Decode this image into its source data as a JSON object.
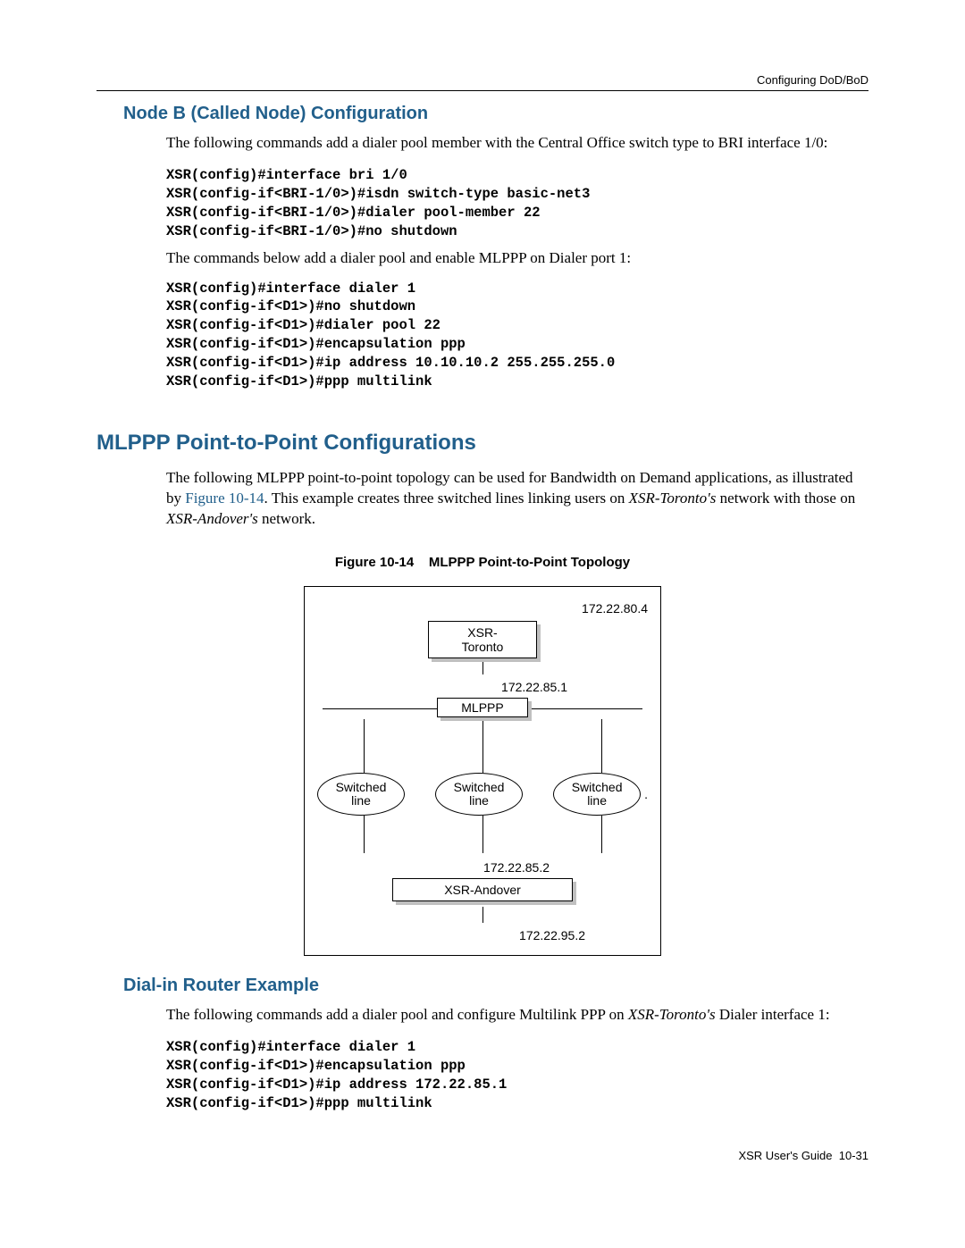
{
  "header": {
    "section": "Configuring DoD/BoD"
  },
  "sec1": {
    "title": "Node B (Called Node) Configuration",
    "p1": "The following commands add a dialer pool member with the Central Office switch type to BRI interface 1/0:",
    "code1": "XSR(config)#interface bri 1/0\nXSR(config-if<BRI-1/0>)#isdn switch-type basic-net3\nXSR(config-if<BRI-1/0>)#dialer pool-member 22\nXSR(config-if<BRI-1/0>)#no shutdown",
    "p2": "The commands below add a dialer pool and enable MLPPP on Dialer port 1:",
    "code2": "XSR(config)#interface dialer 1\nXSR(config-if<D1>)#no shutdown\nXSR(config-if<D1>)#dialer pool 22\nXSR(config-if<D1>)#encapsulation ppp\nXSR(config-if<D1>)#ip address 10.10.10.2 255.255.255.0\nXSR(config-if<D1>)#ppp multilink"
  },
  "sec2": {
    "title": "MLPPP Point-to-Point Configurations",
    "p1a": "The following MLPPP point-to-point topology can be used for Bandwidth on Demand applications, as illustrated by ",
    "fig_link": "Figure 10-14",
    "p1b": ". This example creates three switched lines linking users on ",
    "xsr_t": "XSR-Toronto's",
    "p1c": " network with those on ",
    "xsr_a": "XSR-Andover's",
    "p1d": " network.",
    "fig_caption_num": "Figure 10-14",
    "fig_caption_gap": "    ",
    "fig_caption_title": "MLPPP Point-to-Point Topology"
  },
  "figure": {
    "ip_top": "172.22.80.4",
    "node_top_l1": "XSR-",
    "node_top_l2": "Toronto",
    "ip_mid": "172.22.85.1",
    "mlppp": "MLPPP",
    "sw_l1": "Switched",
    "sw_l2": "line",
    "dot": ".",
    "ip_bot": "172.22.85.2",
    "node_bot": "XSR-Andover",
    "ip_final": "172.22.95.2"
  },
  "sec3": {
    "title": "Dial-in Router Example",
    "p1a": "The following commands add a dialer pool and configure Multilink PPP on ",
    "xsr_t": "XSR-Toronto's",
    "p1b": " Dialer interface 1:",
    "code1": "XSR(config)#interface dialer 1\nXSR(config-if<D1>)#encapsulation ppp\nXSR(config-if<D1>)#ip address 172.22.85.1\nXSR(config-if<D1>)#ppp multilink"
  },
  "footer": {
    "guide": "XSR User's Guide",
    "gap": "  ",
    "page": "10-31"
  }
}
